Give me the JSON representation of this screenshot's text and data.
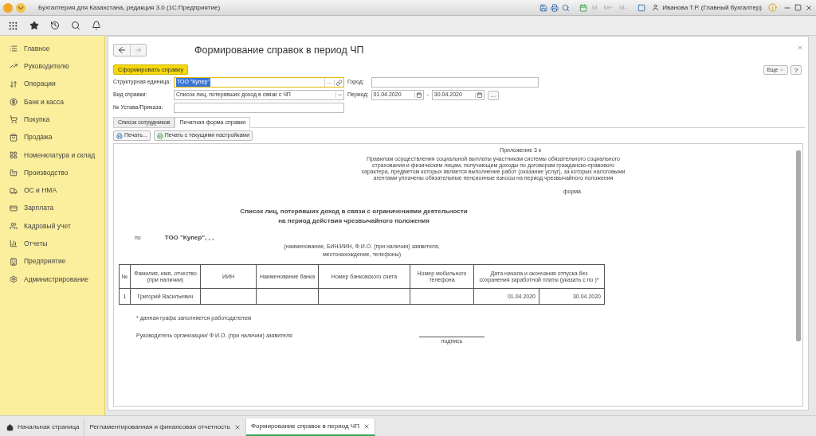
{
  "window": {
    "title": "Бухгалтерия для Казахстана, редакция 3.0  (1С:Предприятие)",
    "memory_buttons": [
      "M",
      "M+",
      "M-"
    ],
    "user": "Иванова Т.Р. (Главный бухгалтер)"
  },
  "sidebar": {
    "items": [
      {
        "label": "Главное"
      },
      {
        "label": "Руководителю"
      },
      {
        "label": "Операции"
      },
      {
        "label": "Банк и касса"
      },
      {
        "label": "Покупка"
      },
      {
        "label": "Продажа"
      },
      {
        "label": "Номенклатура и склад"
      },
      {
        "label": "Производство"
      },
      {
        "label": "ОС и НМА"
      },
      {
        "label": "Зарплата"
      },
      {
        "label": "Кадровый учет"
      },
      {
        "label": "Отчеты"
      },
      {
        "label": "Предприятие"
      },
      {
        "label": "Администрирование"
      }
    ]
  },
  "form": {
    "title": "Формирование справок в период ЧП",
    "generate_button": "Сформировать справку",
    "more_button": "Еще",
    "help_button": "?",
    "unit": {
      "label": "Структурная единица:",
      "value": "ТОО \"Купер\"",
      "selected": true,
      "choose_button": "…"
    },
    "city": {
      "label": "Город:"
    },
    "type": {
      "label": "Вид справки:",
      "value": "Список лиц, потерявших доход в связи с ЧП"
    },
    "period": {
      "label": "Период:",
      "from": "01.04.2020",
      "separator": "-",
      "to": "30.04.2020",
      "more_button": "…"
    },
    "order": {
      "label": "№ Устава/Приказа:"
    },
    "tabs": [
      {
        "label": "Список сотрудников",
        "selected": false
      },
      {
        "label": "Печатная форма справки",
        "selected": true
      }
    ],
    "print_buttons": [
      "Печать...",
      "Печать с текущими настройками"
    ]
  },
  "document": {
    "appendix": "Приложение 3 к",
    "rules": "Правилам осуществления социальной выплаты участникам системы обязательного социального страхования и физическим лицам, получающим доходы по договорам гражданско-правового характера, предметом которых является выполнение работ (оказание услуг), за которых налоговыми агентами уплачены обязательные пенсионные взносы на период чрезвычайного положения",
    "form_label": "форма",
    "heading": [
      "Список лиц, потерявших доход в связи с ограничениями деятельности",
      "на период действия чрезвычайного положения"
    ],
    "by": "по",
    "organization": "ТОО \"Купер\", , ,",
    "org_note": [
      "(наименование, БИН/ИИН, Ф.И.О. (при наличии) заявителя,",
      "местонахождение, телефоны)"
    ],
    "table": {
      "columns": [
        "№",
        "Фамилия, имя, отчество (при наличии)",
        "ИИН",
        "Наименование банка",
        "Номер банковского счета",
        "Номер мобильного телефона",
        "Дата начала и окончания отпуска без сохранения заработной платы (указать с по )*"
      ],
      "rows": [
        [
          "1",
          "Григорий Васильевич",
          "",
          "",
          "",
          "",
          [
            "01.04.2020",
            "30.04.2020"
          ]
        ]
      ]
    },
    "footnote": "* данная графа заполняется работодателем",
    "signer": "Руководитель организации/ Ф.И.О. (при наличии) заявителя",
    "signature": "подпись"
  },
  "bottom_tabs": [
    {
      "label": "Начальная страница",
      "selected": false,
      "home": true,
      "closable": false
    },
    {
      "label": "Регламентированная и финансовая отчетность",
      "selected": false,
      "home": false,
      "closable": true
    },
    {
      "label": "Формирование справок в период ЧП",
      "selected": true,
      "home": false,
      "closable": true
    }
  ]
}
